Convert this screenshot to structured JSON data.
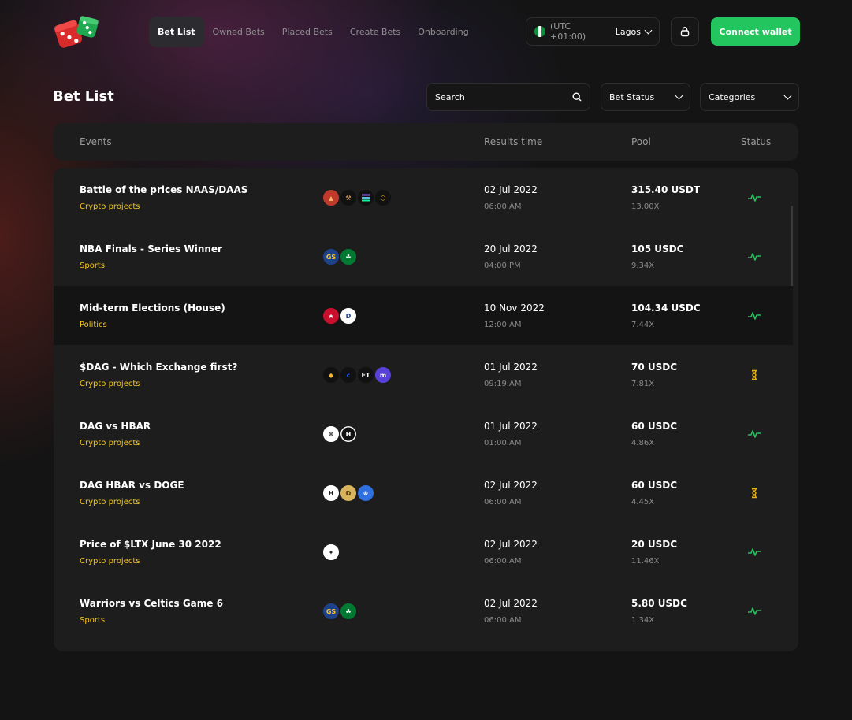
{
  "nav": {
    "items": [
      {
        "label": "Bet List",
        "active": true
      },
      {
        "label": "Owned Bets",
        "active": false
      },
      {
        "label": "Placed Bets",
        "active": false
      },
      {
        "label": "Create Bets",
        "active": false
      },
      {
        "label": "Onboarding",
        "active": false
      }
    ]
  },
  "timezone": {
    "offset": "(UTC +01:00)",
    "city": "Lagos",
    "flag_colors": [
      "#0a8f3c",
      "#ffffff",
      "#0a8f3c"
    ]
  },
  "header": {
    "connect_label": "Connect wallet"
  },
  "page": {
    "title": "Bet List"
  },
  "filters": {
    "search_label": "Search",
    "bet_status_label": "Bet Status",
    "categories_label": "Categories"
  },
  "table": {
    "columns": {
      "events": "Events",
      "results_time": "Results time",
      "pool": "Pool",
      "status": "Status"
    },
    "rows": [
      {
        "title": "Battle of the prices NAAS/DAAS",
        "category": "Crypto projects",
        "icons": [
          "fire-coin-icon",
          "hammer-coin-icon",
          "solana-icon",
          "bancor-icon"
        ],
        "date": "02 Jul 2022",
        "time": "06:00 AM",
        "pool": "315.40 USDT",
        "multiplier": "13.00X",
        "status": "active"
      },
      {
        "title": "NBA Finals - Series Winner",
        "category": "Sports",
        "icons": [
          "warriors-logo-icon",
          "celtics-logo-icon"
        ],
        "date": "20 Jul 2022",
        "time": "04:00 PM",
        "pool": "105 USDC",
        "multiplier": "9.34X",
        "status": "active"
      },
      {
        "title": "Mid-term Elections (House)",
        "category": "Politics",
        "icons": [
          "republican-logo-icon",
          "democrat-logo-icon"
        ],
        "date": "10 Nov 2022",
        "time": "12:00 AM",
        "pool": "104.34 USDC",
        "multiplier": "7.44X",
        "status": "active"
      },
      {
        "title": "$DAG - Which Exchange first?",
        "category": "Crypto projects",
        "icons": [
          "binance-logo-icon",
          "coinbase-logo-icon",
          "ftx-logo-icon",
          "kraken-logo-icon"
        ],
        "date": "01 Jul 2022",
        "time": "09:19 AM",
        "pool": "70 USDC",
        "multiplier": "7.81X",
        "status": "pending"
      },
      {
        "title": "DAG vs HBAR",
        "category": "Crypto projects",
        "icons": [
          "constellation-dag-icon",
          "hbar-icon"
        ],
        "date": "01 Jul 2022",
        "time": "01:00 AM",
        "pool": "60 USDC",
        "multiplier": "4.86X",
        "status": "active"
      },
      {
        "title": "DAG HBAR vs DOGE",
        "category": "Crypto projects",
        "icons": [
          "hbar-icon",
          "doge-icon",
          "constellation-dag-icon"
        ],
        "date": "02 Jul 2022",
        "time": "06:00 AM",
        "pool": "60 USDC",
        "multiplier": "4.45X",
        "status": "pending"
      },
      {
        "title": "Price of $LTX June 30 2022",
        "category": "Crypto projects",
        "icons": [
          "lattice-ltx-icon"
        ],
        "date": "02 Jul 2022",
        "time": "06:00 AM",
        "pool": "20 USDC",
        "multiplier": "11.46X",
        "status": "active"
      },
      {
        "title": "Warriors vs Celtics Game 6",
        "category": "Sports",
        "icons": [
          "warriors-logo-icon",
          "celtics-logo-icon"
        ],
        "date": "02 Jul 2022",
        "time": "06:00 AM",
        "pool": "5.80 USDC",
        "multiplier": "1.34X",
        "status": "active"
      }
    ]
  },
  "colors": {
    "accent_green": "#22c55e",
    "category_yellow": "#f5c518",
    "pending_yellow": "#e8b21c"
  }
}
